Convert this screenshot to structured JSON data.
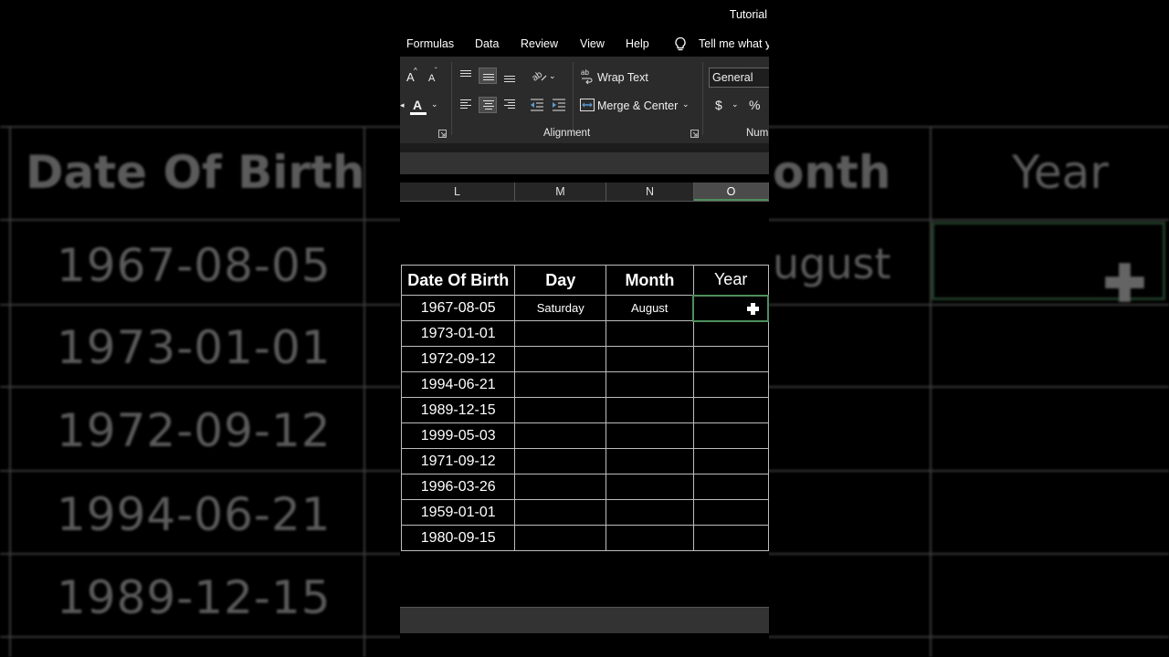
{
  "window": {
    "title": "Tutorial"
  },
  "menu": {
    "items": [
      "Formulas",
      "Data",
      "Review",
      "View",
      "Help"
    ],
    "tell_me": "Tell me what yo"
  },
  "ribbon": {
    "wrap_text": "Wrap Text",
    "merge_center": "Merge & Center",
    "number_format": "General",
    "currency": "$",
    "percent": "%",
    "font_grow": "A",
    "font_shrink": "A",
    "font_color": "A",
    "group_alignment": "Alignment",
    "group_number": "Num"
  },
  "columns": [
    "L",
    "M",
    "N",
    "O"
  ],
  "selected_column": "O",
  "table": {
    "headers": [
      "Date Of Birth",
      "Day",
      "Month",
      "Year"
    ],
    "rows": [
      [
        "1967-08-05",
        "Saturday",
        "August",
        ""
      ],
      [
        "1973-01-01",
        "",
        "",
        ""
      ],
      [
        "1972-09-12",
        "",
        "",
        ""
      ],
      [
        "1994-06-21",
        "",
        "",
        ""
      ],
      [
        "1989-12-15",
        "",
        "",
        ""
      ],
      [
        "1999-05-03",
        "",
        "",
        ""
      ],
      [
        "1971-09-12",
        "",
        "",
        ""
      ],
      [
        "1996-03-26",
        "",
        "",
        ""
      ],
      [
        "1959-01-01",
        "",
        "",
        ""
      ],
      [
        "1980-09-15",
        "",
        "",
        ""
      ]
    ]
  },
  "background_zoom": {
    "headers": [
      "Date Of Birth",
      "onth",
      "Year"
    ],
    "dates": [
      "1967-08-05",
      "1973-01-01",
      "1972-09-12",
      "1994-06-21",
      "1989-12-15"
    ],
    "month_value": "ugust"
  },
  "colors": {
    "selection": "#4e8f5c",
    "ribbon": "#2b2b2b"
  }
}
